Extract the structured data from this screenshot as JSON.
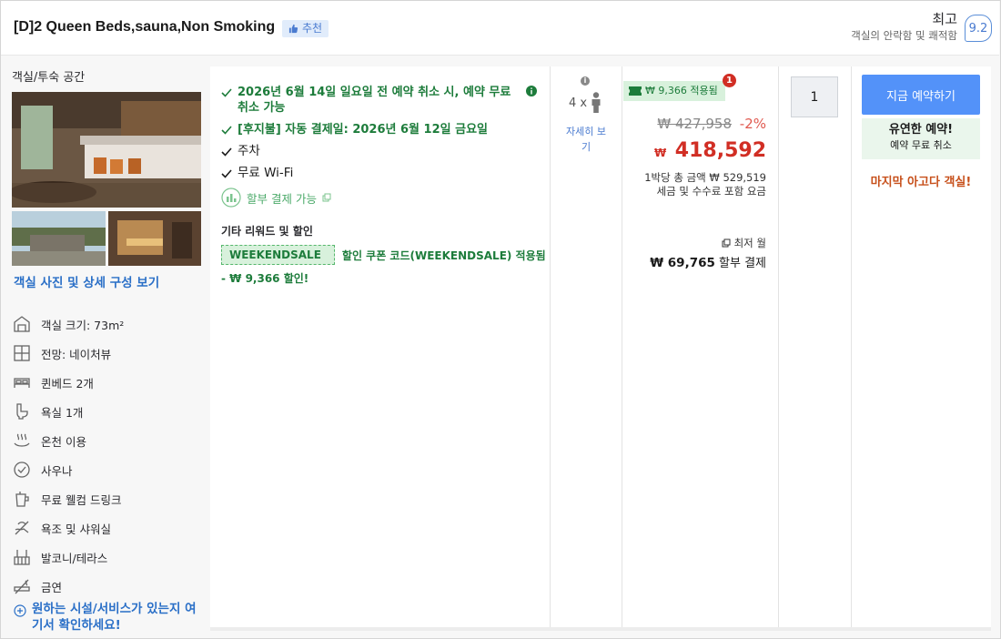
{
  "header": {
    "room_title": "[D]2 Queen Beds,sauna,Non Smoking",
    "recommend_label": "추천",
    "rating_label": "최고",
    "rating_sub": "객실의 안락함 및 쾌적함",
    "rating_score": "9.2"
  },
  "left": {
    "heading": "객실/투숙 공간",
    "photos_link": "객실 사진 및 상세 구성 보기",
    "amenities": [
      {
        "icon": "room-size-icon",
        "label": "객실 크기: 73m²"
      },
      {
        "icon": "window-view-icon",
        "label": "전망: 네이처뷰"
      },
      {
        "icon": "bed-icon",
        "label": "퀸베드 2개"
      },
      {
        "icon": "toilet-icon",
        "label": "욕실 1개"
      },
      {
        "icon": "hot-spring-icon",
        "label": "온천 이용"
      },
      {
        "icon": "sauna-icon",
        "label": "사우나"
      },
      {
        "icon": "drink-cup-icon",
        "label": "무료 웰컴 드링크"
      },
      {
        "icon": "shower-icon",
        "label": "욕조 및 샤워실"
      },
      {
        "icon": "balcony-icon",
        "label": "발코니/테라스"
      },
      {
        "icon": "no-smoking-icon",
        "label": "금연"
      }
    ],
    "facility_link": "원하는 시설/서비스가 있는지 여기서 확인하세요!"
  },
  "conditions": {
    "cancel": "2026년 6월 14일 일요일 전 예약 취소 시, 예약 무료 취소 가능",
    "pay_later": "[후지불] 자동 결제일: 2026년 6월 12일 금요일",
    "parking": "주차",
    "wifi": "무료 Wi-Fi",
    "installment": "할부 결제 가능",
    "other_title": "기타 리워드 및 할인",
    "coupon_code": "WEEKENDSALE",
    "coupon_text": "할인 쿠폰 코드(WEEKENDSALE) 적용됨",
    "coupon_discount": "- ₩ 9,366 할인!"
  },
  "occupancy": {
    "count_label": "4 x",
    "details_link": "자세히 보기"
  },
  "price": {
    "applied_badge": "₩ 9,366 적용됨",
    "alert_count": "1",
    "original": "₩ 427,958",
    "discount_pct": "-2%",
    "currency": "₩",
    "final": "418,592",
    "total_line": "1박당 총 금액 ₩ 529,519",
    "tax_line": "세금 및 수수료 포함 요금",
    "monthly_label": "최저 월",
    "monthly_amount": "₩ 69,765",
    "monthly_suffix": "할부 결제"
  },
  "quantity": {
    "value": "1"
  },
  "booking": {
    "button_label": "지금 예약하기",
    "flex_title": "유연한 예약!",
    "flex_sub": "예약 무료 취소",
    "last_room": "마지막 아고다 객실!"
  },
  "colors": {
    "accent_blue": "#5392f9",
    "link_blue": "#2a6fc7",
    "green": "#1d7c3b",
    "price_red": "#d12e24",
    "urgency_orange": "#c7501b"
  }
}
